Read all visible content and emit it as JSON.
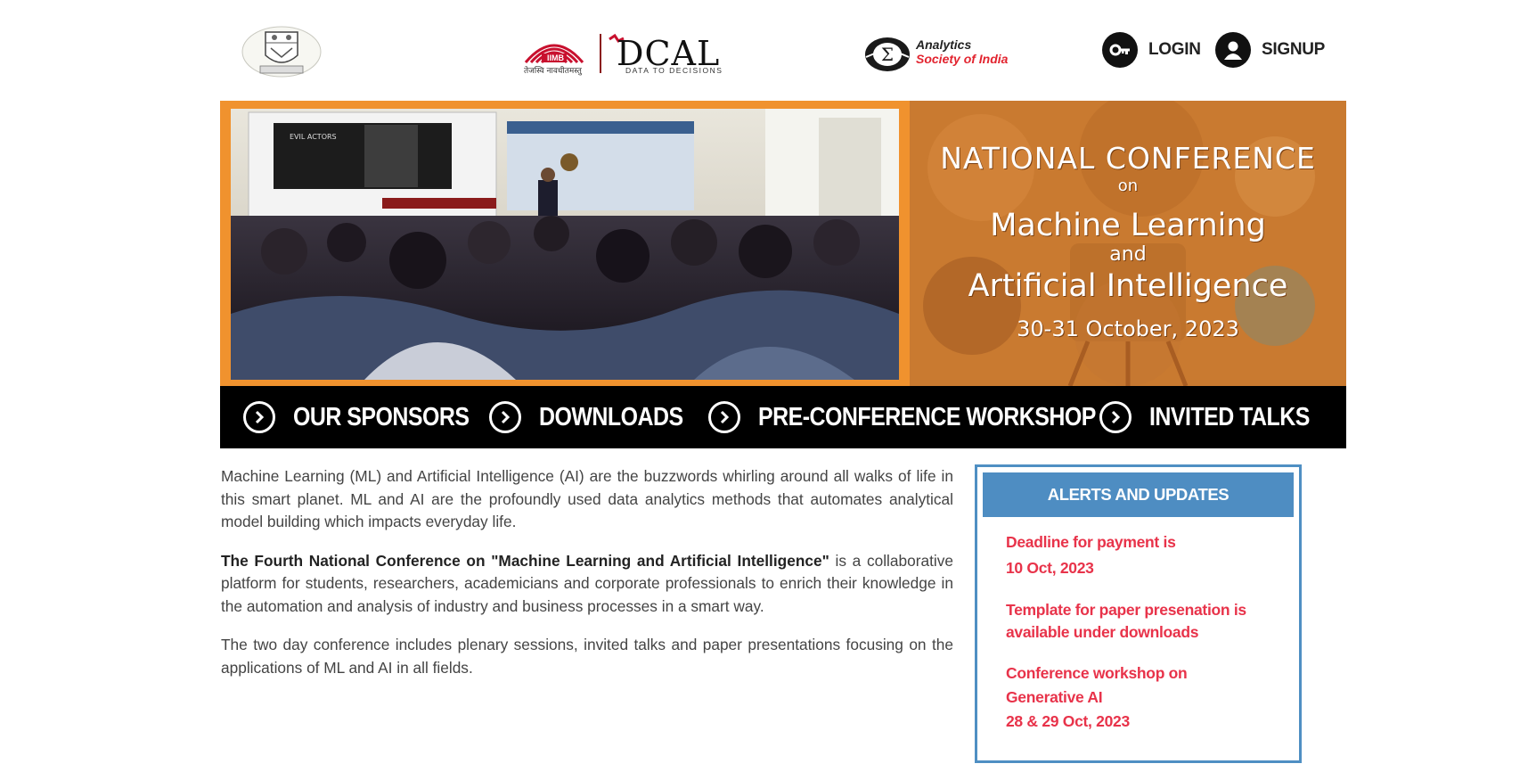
{
  "header": {
    "logos": [
      "college-crest",
      "iimb-dcal-logo",
      "analytics-society-of-india-logo"
    ],
    "iimb_text": "IIMB",
    "dcal_text": "DCAL",
    "dcal_tagline": "DATA TO DECISIONS",
    "iimb_motto": "तेजस्वि नावधीतमस्तु",
    "asi_line1": "Analytics",
    "asi_line2": "Society of India",
    "login_label": "LOGIN",
    "signup_label": "SIGNUP"
  },
  "banner": {
    "line1": "NATIONAL CONFERENCE",
    "line2": "on",
    "line3": "Machine Learning",
    "line4": "and",
    "line5": "Artificial Intelligence",
    "line6": "30-31 October, 2023",
    "colors": {
      "frame": "#f0922e",
      "panel": "#c97a30"
    }
  },
  "nav": {
    "items": [
      {
        "label": "OUR SPONSORS",
        "icon": "chevron-right-circle-icon"
      },
      {
        "label": "DOWNLOADS",
        "icon": "chevron-right-circle-icon"
      },
      {
        "label": "PRE-CONFERENCE WORKSHOP",
        "icon": "chevron-right-circle-icon"
      },
      {
        "label": "INVITED TALKS",
        "icon": "chevron-right-circle-icon"
      }
    ]
  },
  "main": {
    "p1": "Machine Learning (ML) and Artificial Intelligence (AI) are the buzzwords whirling around all walks of life in this smart planet. ML and AI are the profoundly used data analytics methods that automates analytical model building which impacts everyday life.",
    "p2_bold": "The Fourth National Conference on \"Machine Learning and Artificial Intelligence\"",
    "p2_rest": " is a collaborative platform for students, researchers, academicians and corporate professionals to enrich their knowledge in the automation and analysis of industry and business processes in a smart way.",
    "p3": "The two day conference includes plenary sessions, invited talks and paper presentations focusing on the applications of ML and AI in all fields."
  },
  "alerts": {
    "title": "ALERTS AND UPDATES",
    "items": [
      {
        "line1": "Deadline for payment is",
        "line2": "10 Oct, 2023"
      },
      {
        "line1": "Template for paper presenation is",
        "line2": "available under downloads"
      },
      {
        "line1": "Conference workshop on",
        "line2": "Generative AI",
        "line3": "28 & 29 Oct, 2023"
      }
    ],
    "colors": {
      "header": "#4e8dc2",
      "text": "#e8334a"
    }
  }
}
